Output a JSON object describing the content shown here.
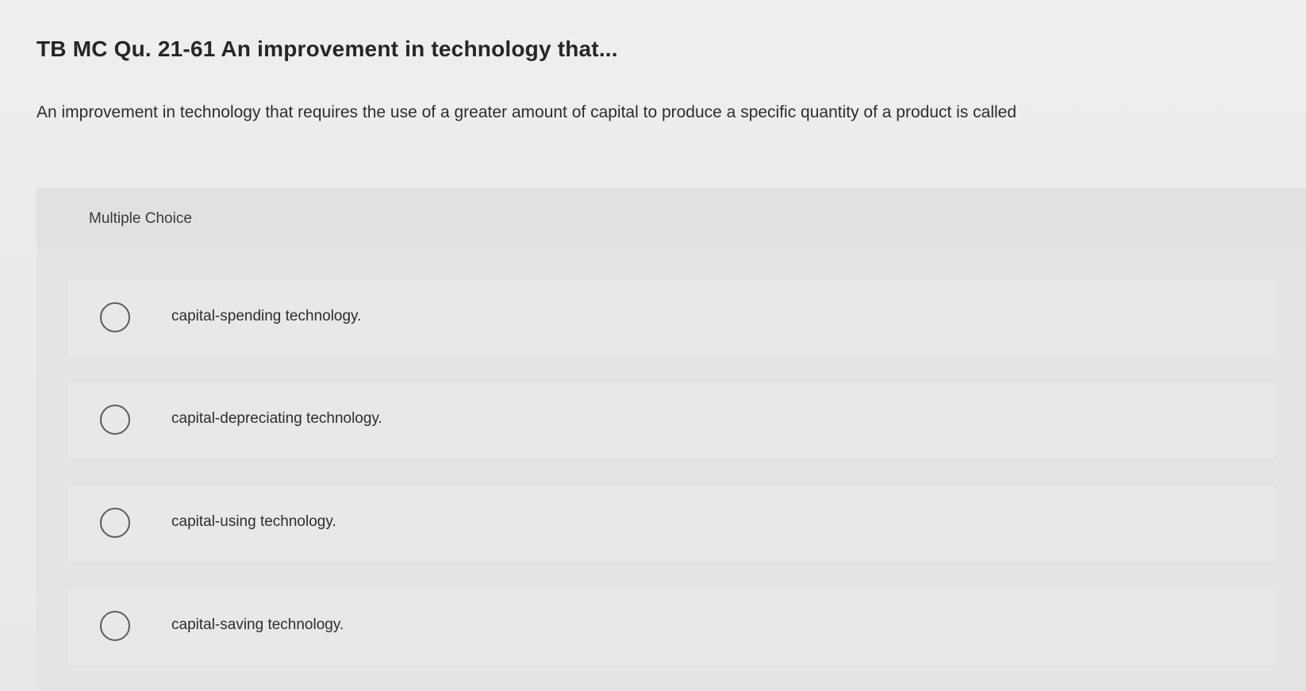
{
  "question": {
    "title": "TB MC Qu. 21-61 An improvement in technology that...",
    "stem": "An improvement in technology that requires the use of a greater amount of capital to produce a specific quantity of a product is called"
  },
  "multiple_choice": {
    "label": "Multiple Choice",
    "options": [
      {
        "label": "capital-spending technology."
      },
      {
        "label": "capital-depreciating technology."
      },
      {
        "label": "capital-using technology."
      },
      {
        "label": "capital-saving technology."
      }
    ]
  }
}
